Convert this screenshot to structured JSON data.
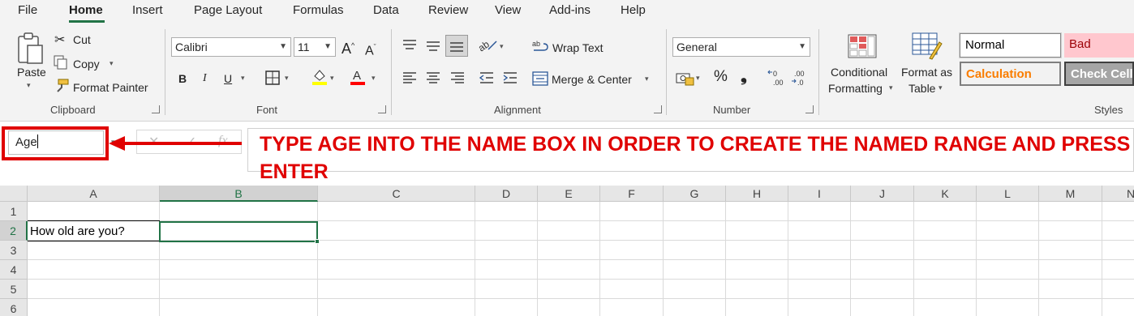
{
  "menu": {
    "tabs": [
      "File",
      "Home",
      "Insert",
      "Page Layout",
      "Formulas",
      "Data",
      "Review",
      "View",
      "Add-ins",
      "Help"
    ],
    "active_tab": "Home"
  },
  "clipboard": {
    "paste": "Paste",
    "cut": "Cut",
    "copy": "Copy",
    "format_painter": "Format Painter",
    "group": "Clipboard"
  },
  "font": {
    "name": "Calibri",
    "size": "11",
    "bold": "B",
    "italic": "I",
    "underline": "U",
    "group": "Font",
    "fill_color": "#ffff00",
    "font_color": "#ff0000"
  },
  "alignment": {
    "wrap_text": "Wrap Text",
    "merge_center": "Merge & Center",
    "group": "Alignment"
  },
  "number": {
    "format": "General",
    "currency_symbol": "%",
    "comma": "❟",
    "group": "Number"
  },
  "styles": {
    "conditional_formatting": [
      "Conditional",
      "Formatting"
    ],
    "format_as_table": [
      "Format as",
      "Table"
    ],
    "normal": "Normal",
    "bad": "Bad",
    "calculation": "Calculation",
    "check_cell": "Check Cell",
    "group": "Styles",
    "bad_bg": "#ffc7ce",
    "bad_fg": "#9c0006",
    "calc_fg": "#fa7d00",
    "check_bg": "#a5a5a5"
  },
  "formula_bar": {
    "name_box_value": "Age",
    "fx": "fx",
    "annotation": "TYPE AGE INTO THE NAME BOX IN ORDER TO CREATE THE NAMED RANGE AND PRESS ENTER",
    "annotation_color": "#e00000"
  },
  "grid": {
    "columns": [
      "A",
      "B",
      "C",
      "D",
      "E",
      "F",
      "G",
      "H",
      "I",
      "J",
      "K",
      "L",
      "M",
      "N"
    ],
    "rows": [
      "1",
      "2",
      "3",
      "4",
      "5",
      "6"
    ],
    "selected_column": "B",
    "selected_row": "2",
    "cells": {
      "A2": "How old are you?"
    }
  }
}
